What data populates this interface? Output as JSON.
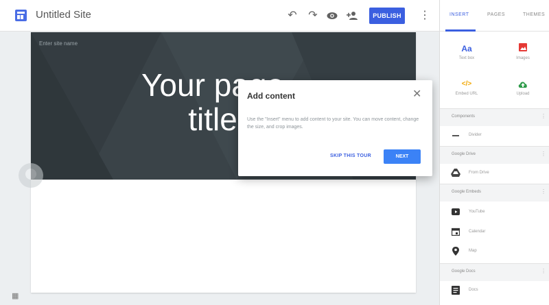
{
  "topbar": {
    "site_title": "Untitled Site",
    "icons": [
      "undo-icon",
      "redo-icon",
      "preview-eye-icon",
      "add-person-icon"
    ],
    "publish_label": "PUBLISH"
  },
  "canvas": {
    "site_name_placeholder": "Enter site name",
    "hero_title": "Your page title",
    "hero_color": "#3a4348"
  },
  "dialog": {
    "title": "Add content",
    "body": "Use the \"Insert\" menu to add content to your site. You can move content, change the size, and crop images.",
    "skip_label": "SKIP THIS TOUR",
    "next_label": "NEXT"
  },
  "panel": {
    "tabs": [
      {
        "label": "INSERT",
        "active": true
      },
      {
        "label": "PAGES",
        "active": false
      },
      {
        "label": "THEMES",
        "active": false
      }
    ],
    "tiles": [
      {
        "label": "Text box",
        "icon": "Aa",
        "color": "#3b5fe0"
      },
      {
        "label": "Images",
        "icon": "image-icon",
        "color": "#e53935"
      },
      {
        "label": "Embed URL",
        "icon": "</>",
        "color": "#f2a600"
      },
      {
        "label": "Upload",
        "icon": "cloud-upload-icon",
        "color": "#2e9b4a"
      }
    ],
    "sections": [
      {
        "title": "Components",
        "items": [
          {
            "label": "Divider",
            "icon": "divider-icon"
          }
        ]
      },
      {
        "title": "Google Drive",
        "items": [
          {
            "label": "From Drive",
            "icon": "drive-icon"
          }
        ]
      },
      {
        "title": "Google Embeds",
        "items": [
          {
            "label": "YouTube",
            "icon": "youtube-icon"
          },
          {
            "label": "Calendar",
            "icon": "calendar-icon"
          },
          {
            "label": "Map",
            "icon": "map-pin-icon"
          }
        ]
      },
      {
        "title": "Google Docs",
        "items": [
          {
            "label": "Docs",
            "icon": "docs-icon"
          }
        ]
      }
    ]
  },
  "colors": {
    "accent": "#3b5fe0",
    "next_button": "#3b82f6"
  }
}
